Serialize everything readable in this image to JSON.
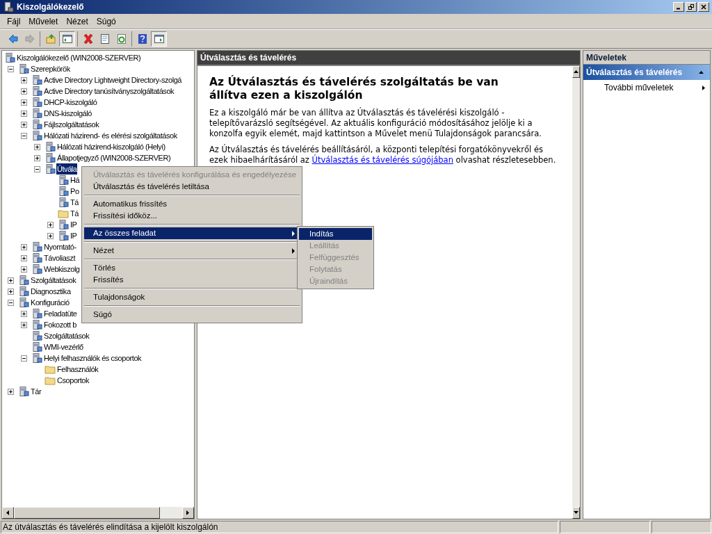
{
  "window": {
    "title": "Kiszolgálókezelő"
  },
  "menu_bar": [
    "Fájl",
    "Művelet",
    "Nézet",
    "Súgó"
  ],
  "toolbar": [
    [
      {
        "kind": "back",
        "disabled": false,
        "pressed": false
      },
      {
        "kind": "forward",
        "disabled": true,
        "pressed": false
      }
    ],
    [
      {
        "kind": "up",
        "disabled": false,
        "pressed": false
      },
      {
        "kind": "tree",
        "disabled": false,
        "pressed": true
      }
    ],
    [
      {
        "kind": "delete",
        "disabled": false,
        "pressed": false
      },
      {
        "kind": "properties",
        "disabled": false,
        "pressed": false
      },
      {
        "kind": "refresh",
        "disabled": false,
        "pressed": false
      }
    ],
    [
      {
        "kind": "help",
        "disabled": false,
        "pressed": false
      },
      {
        "kind": "actionpane",
        "disabled": false,
        "pressed": true
      }
    ]
  ],
  "tree": [
    {
      "label": "Kiszolgálókezelő (WIN2008-SZERVER)",
      "kind": "node",
      "selected": false,
      "children": [
        {
          "label": "Szerepkörök",
          "kind": "node",
          "selected": false,
          "expanded": true,
          "children": [
            {
              "label": "Active Directory Lightweight Directory-szolgá",
              "kind": "node",
              "selected": false,
              "expanded": false
            },
            {
              "label": "Active Directory tanúsítványszolgáltatások",
              "kind": "node",
              "selected": false,
              "expanded": false
            },
            {
              "label": "DHCP-kiszolgáló",
              "kind": "node",
              "selected": false,
              "expanded": false
            },
            {
              "label": "DNS-kiszolgáló",
              "kind": "node",
              "selected": false,
              "expanded": false
            },
            {
              "label": "Fájlszolgáltatások",
              "kind": "node",
              "selected": false,
              "expanded": false
            },
            {
              "label": "Hálózati házirend- és elérési szolgáltatások",
              "kind": "node",
              "selected": false,
              "expanded": true,
              "children": [
                {
                  "label": "Hálózati házirend-kiszolgáló (Helyi)",
                  "kind": "node",
                  "selected": false,
                  "expanded": false
                },
                {
                  "label": "Állapotjegyző (WIN2008-SZERVER)",
                  "kind": "node",
                  "selected": false,
                  "expanded": false
                },
                {
                  "label": "Útvála",
                  "kind": "node",
                  "selected": true,
                  "expanded": true,
                  "children": [
                    {
                      "label": "Há",
                      "kind": "node",
                      "selected": false
                    },
                    {
                      "label": "Po",
                      "kind": "node",
                      "selected": false
                    },
                    {
                      "label": "Tá",
                      "kind": "node",
                      "selected": false
                    },
                    {
                      "label": "Tá",
                      "kind": "folder",
                      "selected": false
                    },
                    {
                      "label": "IP",
                      "kind": "node",
                      "selected": false,
                      "expanded": false
                    },
                    {
                      "label": "IP",
                      "kind": "node",
                      "selected": false,
                      "expanded": false
                    }
                  ]
                }
              ]
            },
            {
              "label": "Nyomtató-",
              "kind": "node",
              "selected": false,
              "expanded": false
            },
            {
              "label": "Távoliaszt",
              "kind": "node",
              "selected": false,
              "expanded": false
            },
            {
              "label": "Webkiszolg",
              "kind": "node",
              "selected": false,
              "expanded": false
            }
          ]
        },
        {
          "label": "Szolgáltatások",
          "kind": "node",
          "selected": false,
          "expanded": false
        },
        {
          "label": "Diagnosztika",
          "kind": "node",
          "selected": false,
          "expanded": false
        },
        {
          "label": "Konfiguráció",
          "kind": "node",
          "selected": false,
          "expanded": true,
          "children": [
            {
              "label": "Feladatüte",
              "kind": "node",
              "selected": false,
              "expanded": false
            },
            {
              "label": "Fokozott b",
              "kind": "node",
              "selected": false,
              "expanded": false
            },
            {
              "label": "Szolgáltatások",
              "kind": "node",
              "selected": false
            },
            {
              "label": "WMI-vezérlő",
              "kind": "node",
              "selected": false
            },
            {
              "label": "Helyi felhasználók és csoportok",
              "kind": "node",
              "selected": false,
              "expanded": true,
              "children": [
                {
                  "label": "Felhasználók",
                  "kind": "folder",
                  "selected": false
                },
                {
                  "label": "Csoportok",
                  "kind": "folder",
                  "selected": false
                }
              ]
            }
          ]
        },
        {
          "label": "Tár",
          "kind": "node",
          "selected": false,
          "expanded": false
        }
      ]
    }
  ],
  "content": {
    "title": "Útválasztás és távelérés",
    "heading": "Az Útválasztás és távelérés szolgáltatás be van állítva ezen a kiszolgálón",
    "paragraph": "Ez a kiszolgáló már be van állítva az Útválasztás és távelérési kiszolgáló - telepítővarázsló segítségével. Az aktuális konfiguráció módosításához jelölje ki a konzolfa egyik elemét, majd kattintson a Művelet menü Tulajdonságok parancsára.",
    "paragraph2_before": "Az Útválasztás és távelérés beállításáról, a központi telepítési forgatókönyvekről és ezek hibaelhárításáról az",
    "paragraph2_link": "Útválasztás és távelérés súgójában",
    "paragraph2_after": "olvashat részletesebben."
  },
  "actions": {
    "title": "Műveletek",
    "section": {
      "title": "Útválasztás és távelérés",
      "expanded": true,
      "items": [
        {
          "label": "További műveletek",
          "has_submenu": true
        }
      ]
    }
  },
  "context_menu": {
    "groups": [
      [
        {
          "label": "Útválasztás és távelérés konfigurálása és engedélyezése",
          "disabled": true,
          "selected": false,
          "has_submenu": false
        },
        {
          "label": "Útválasztás és távelérés letiltása",
          "disabled": false,
          "selected": false,
          "has_submenu": false
        }
      ],
      [
        {
          "label": "Automatikus frissítés",
          "disabled": false,
          "selected": false,
          "has_submenu": false
        },
        {
          "label": "Frissítési időköz...",
          "disabled": false,
          "selected": false,
          "has_submenu": false
        }
      ],
      [
        {
          "label": "Az összes feladat",
          "disabled": false,
          "selected": true,
          "has_submenu": true
        }
      ],
      [
        {
          "label": "Nézet",
          "disabled": false,
          "selected": false,
          "has_submenu": true
        }
      ],
      [
        {
          "label": "Törlés",
          "disabled": false,
          "selected": false,
          "has_submenu": false
        },
        {
          "label": "Frissítés",
          "disabled": false,
          "selected": false,
          "has_submenu": false
        }
      ],
      [
        {
          "label": "Tulajdonságok",
          "disabled": false,
          "selected": false,
          "has_submenu": false
        }
      ],
      [
        {
          "label": "Súgó",
          "disabled": false,
          "selected": false,
          "has_submenu": false
        }
      ]
    ],
    "submenu": [
      {
        "label": "Indítás",
        "disabled": false,
        "selected": true
      },
      {
        "label": "Leállítás",
        "disabled": true,
        "selected": false
      },
      {
        "label": "Felfüggesztés",
        "disabled": true,
        "selected": false
      },
      {
        "label": "Folytatás",
        "disabled": true,
        "selected": false
      },
      {
        "label": "Újraindítás",
        "disabled": true,
        "selected": false
      }
    ]
  },
  "status_bar": {
    "text": "Az útválasztás és távelérés elindítása a kijelölt kiszolgálón"
  }
}
